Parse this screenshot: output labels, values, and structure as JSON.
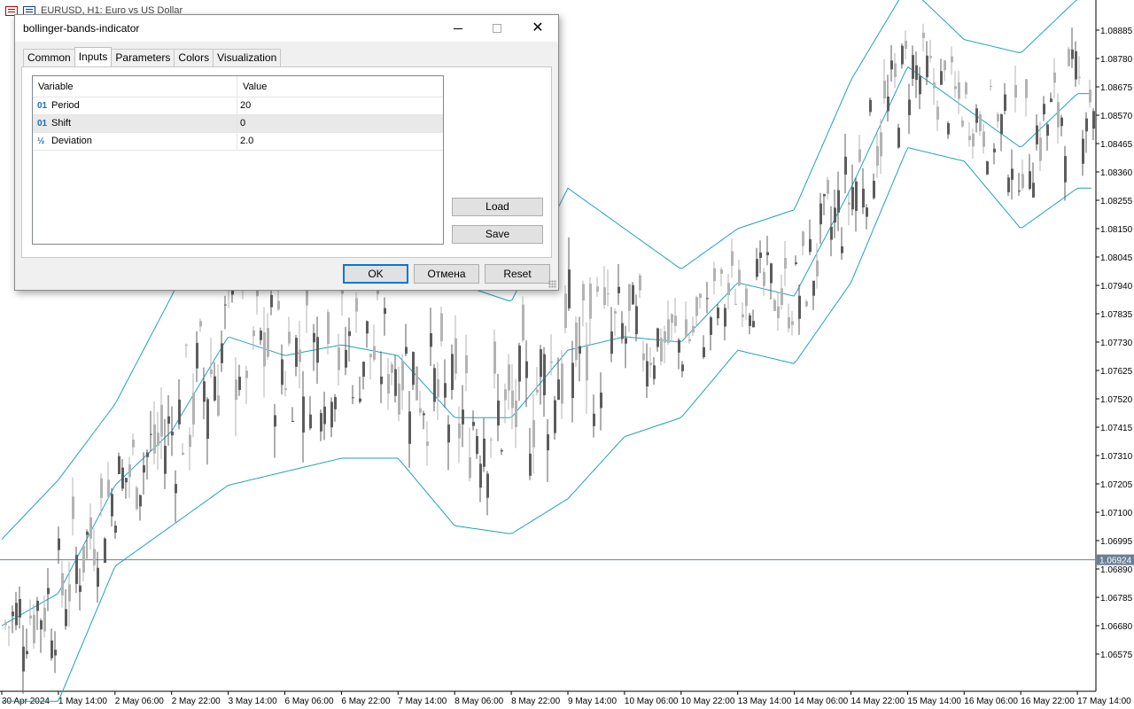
{
  "chart": {
    "title": "EURUSD, H1:  Euro vs US Dollar",
    "price_labels": [
      "1.08885",
      "1.08780",
      "1.08675",
      "1.08570",
      "1.08465",
      "1.08360",
      "1.08255",
      "1.08150",
      "1.08045",
      "1.07940",
      "1.07835",
      "1.07730",
      "1.07625",
      "1.07520",
      "1.07415",
      "1.07310",
      "1.07205",
      "1.07100",
      "1.06995",
      "1.06890",
      "1.06785",
      "1.06680",
      "1.06575"
    ],
    "current_price": "1.06924",
    "time_labels": [
      "30 Apr 2024",
      "1 May 14:00",
      "2 May 06:00",
      "2 May 22:00",
      "3 May 14:00",
      "6 May 06:00",
      "6 May 22:00",
      "7 May 14:00",
      "8 May 06:00",
      "8 May 22:00",
      "9 May 14:00",
      "10 May 06:00",
      "10 May 22:00",
      "13 May 14:00",
      "14 May 06:00",
      "14 May 22:00",
      "15 May 14:00",
      "16 May 06:00",
      "16 May 22:00",
      "17 May 14:00"
    ],
    "colors": {
      "band": "#1ea3b5",
      "candle_up": "#b3b3b3",
      "candle_down": "#5c5c5c",
      "price_line": "#6b7f96",
      "price_tag_bg": "#6b7f96"
    }
  },
  "chart_data": {
    "type": "candlestick",
    "ylim": [
      1.065,
      1.09
    ],
    "x": [
      "30 Apr 2024",
      "1 May 14:00",
      "2 May 06:00",
      "2 May 22:00",
      "3 May 14:00",
      "6 May 06:00",
      "6 May 22:00",
      "7 May 14:00",
      "8 May 06:00",
      "8 May 22:00",
      "9 May 14:00",
      "10 May 06:00",
      "10 May 22:00",
      "13 May 14:00",
      "14 May 06:00",
      "14 May 22:00",
      "15 May 14:00",
      "16 May 06:00",
      "16 May 22:00",
      "17 May 14:00"
    ],
    "series": [
      {
        "values": [
          1.0668,
          1.068,
          1.072,
          1.074,
          1.0775,
          1.0768,
          1.0772,
          1.0768,
          1.0745,
          1.0745,
          1.077,
          1.0775,
          1.0773,
          1.0795,
          1.079,
          1.083,
          1.0875,
          1.086,
          1.0845,
          1.0865
        ]
      },
      {
        "values": [
          1.07,
          1.0722,
          1.075,
          1.079,
          1.0835,
          1.0815,
          1.0818,
          1.081,
          1.0795,
          1.0788,
          1.083,
          1.0815,
          1.08,
          1.0815,
          1.0822,
          1.087,
          1.0905,
          1.0885,
          1.088,
          1.09
        ]
      },
      {
        "values": [
          1.064,
          1.064,
          1.069,
          1.0705,
          1.072,
          1.0725,
          1.073,
          1.073,
          1.0705,
          1.0702,
          1.0715,
          1.0738,
          1.0745,
          1.077,
          1.0765,
          1.0795,
          1.0845,
          1.084,
          1.0815,
          1.083
        ]
      }
    ]
  },
  "dialog": {
    "title": "bollinger-bands-indicator",
    "tabs": [
      "Common",
      "Inputs",
      "Parameters",
      "Colors",
      "Visualization"
    ],
    "active_tab": "Inputs",
    "grid": {
      "headers": [
        "Variable",
        "Value"
      ],
      "rows": [
        {
          "icon": "01",
          "variable": "Period",
          "value": "20"
        },
        {
          "icon": "01",
          "variable": "Shift",
          "value": "0"
        },
        {
          "icon": "½",
          "variable": "Deviation",
          "value": "2.0"
        }
      ]
    },
    "buttons": {
      "load": "Load",
      "save": "Save",
      "ok": "OK",
      "cancel": "Отмена",
      "reset": "Reset"
    }
  }
}
